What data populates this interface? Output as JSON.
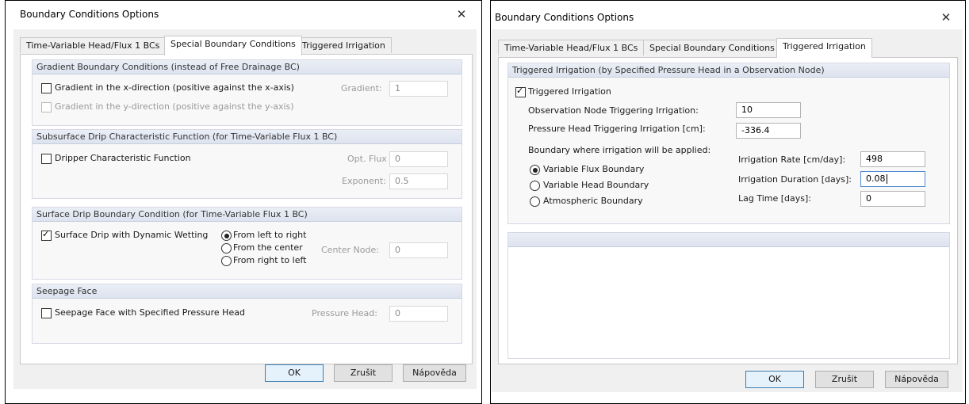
{
  "left_dialog": {
    "title": "Boundary Conditions Options",
    "close_glyph": "✕",
    "tabs": [
      {
        "label": "Time-Variable Head/Flux 1 BCs"
      },
      {
        "label": "Special Boundary Conditions"
      },
      {
        "label": "Triggered Irrigation"
      }
    ],
    "active_tab": "Special Boundary Conditions",
    "gradient_group": {
      "header": "Gradient Boundary Conditions (instead of Free Drainage BC)",
      "x_direction_label": "Gradient in the x-direction (positive against the x-axis)",
      "y_direction_label": "Gradient in the y-direction (positive against the y-axis)",
      "gradient_label": "Gradient:",
      "gradient_value": "1"
    },
    "drip_group": {
      "header": "Subsurface Drip Characteristic Function (for Time-Variable Flux 1 BC)",
      "dripper_label": "Dripper Characteristic Function",
      "opt_flux_label": "Opt. Flux",
      "opt_flux_value": "0",
      "exponent_label": "Exponent:",
      "exponent_value": "0.5"
    },
    "surface_group": {
      "header": "Surface Drip Boundary Condition (for Time-Variable Flux 1 BC)",
      "dynamic_wetting_label": "Surface Drip with Dynamic Wetting",
      "radio_left_to_right": "From left to right",
      "radio_center": "From the center",
      "radio_right_to_left": "From right to left",
      "center_node_label": "Center Node:",
      "center_node_value": "0"
    },
    "seepage_group": {
      "header": "Seepage Face",
      "seepage_label": "Seepage Face with Specified Pressure Head",
      "pressure_head_label": "Pressure Head:",
      "pressure_head_value": "0"
    },
    "buttons": {
      "ok": "OK",
      "cancel": "Zrušit",
      "help": "Nápověda"
    }
  },
  "right_dialog": {
    "title": "Boundary Conditions Options",
    "close_glyph": "✕",
    "tabs": [
      {
        "label": "Time-Variable Head/Flux 1 BCs"
      },
      {
        "label": "Special Boundary Conditions"
      },
      {
        "label": "Triggered Irrigation"
      }
    ],
    "active_tab": "Triggered Irrigation",
    "irrigation_group": {
      "header": "Triggered Irrigation (by Specified Pressure Head in a Observation Node)",
      "triggered_label": "Triggered Irrigation",
      "obs_node_label": "Observation Node Triggering Irrigation:",
      "obs_node_value": "10",
      "pressure_head_label": "Pressure Head Triggering Irrigation [cm]:",
      "pressure_head_value": "-336.4",
      "boundary_label": "Boundary where irrigation will be applied:",
      "radio_variable_flux": "Variable Flux Boundary",
      "radio_variable_head": "Variable Head Boundary",
      "radio_atmospheric": "Atmospheric Boundary",
      "rate_label": "Irrigation Rate [cm/day]:",
      "rate_value": "498",
      "duration_label": "Irrigation Duration [days]:",
      "duration_value": "0.08",
      "lag_label": "Lag Time [days]:",
      "lag_value": "0"
    },
    "buttons": {
      "ok": "OK",
      "cancel": "Zrušit",
      "help": "Nápověda"
    }
  }
}
